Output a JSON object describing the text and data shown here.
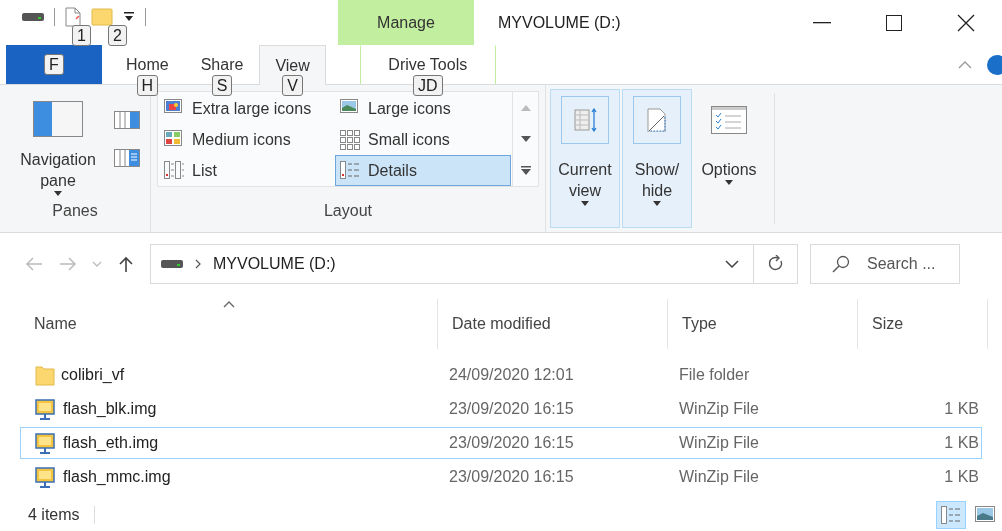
{
  "window": {
    "title": "MYVOLUME (D:)"
  },
  "quick_access": {
    "keytips": [
      "1",
      "2"
    ]
  },
  "context_tab_group": "Manage",
  "tabs": [
    {
      "kind": "file",
      "keytip": "F",
      "selected": false
    },
    {
      "kind": "normal",
      "label": "Home",
      "keytip": "H",
      "selected": false
    },
    {
      "kind": "normal",
      "label": "Share",
      "keytip": "S",
      "selected": false
    },
    {
      "kind": "normal",
      "label": "View",
      "keytip": "V",
      "selected": true
    },
    {
      "kind": "context",
      "label": "Drive Tools",
      "keytip": "JD",
      "selected": false
    }
  ],
  "ribbon": {
    "panes": {
      "navigation_pane": "Navigation pane",
      "label": "Panes"
    },
    "layout": {
      "label": "Layout",
      "items": [
        {
          "label": "Extra large icons",
          "kind": "xl",
          "selected": false
        },
        {
          "label": "Large icons",
          "kind": "lg",
          "selected": false
        },
        {
          "label": "Medium icons",
          "kind": "md",
          "selected": false
        },
        {
          "label": "Small icons",
          "kind": "sm",
          "selected": false
        },
        {
          "label": "List",
          "kind": "list",
          "selected": false
        },
        {
          "label": "Details",
          "kind": "details",
          "selected": true
        }
      ]
    },
    "big_buttons": [
      {
        "kind": "current_view",
        "label": "Current view",
        "active": true
      },
      {
        "kind": "show_hide",
        "label": "Show/ hide",
        "active": true
      },
      {
        "kind": "options",
        "label": "Options",
        "active": false
      }
    ]
  },
  "address_bar": {
    "path": "MYVOLUME (D:)",
    "search_placeholder": "Search ..."
  },
  "columns": [
    {
      "label": "Name",
      "sorted": true
    },
    {
      "label": "Date modified",
      "sorted": false
    },
    {
      "label": "Type",
      "sorted": false
    },
    {
      "label": "Size",
      "sorted": false
    }
  ],
  "rows": [
    {
      "kind": "folder",
      "name": "colibri_vf",
      "date": "24/09/2020 12:01",
      "type": "File folder",
      "size": "",
      "focused": false
    },
    {
      "kind": "image",
      "name": "flash_blk.img",
      "date": "23/09/2020 16:15",
      "type": "WinZip File",
      "size": "1 KB",
      "focused": false
    },
    {
      "kind": "image",
      "name": "flash_eth.img",
      "date": "23/09/2020 16:15",
      "type": "WinZip File",
      "size": "1 KB",
      "focused": true
    },
    {
      "kind": "image",
      "name": "flash_mmc.img",
      "date": "23/09/2020 16:15",
      "type": "WinZip File",
      "size": "1 KB",
      "focused": false
    }
  ],
  "status_bar": {
    "item_count": "4 items",
    "views": [
      {
        "kind": "details",
        "selected": true
      },
      {
        "kind": "large",
        "selected": false
      }
    ]
  }
}
